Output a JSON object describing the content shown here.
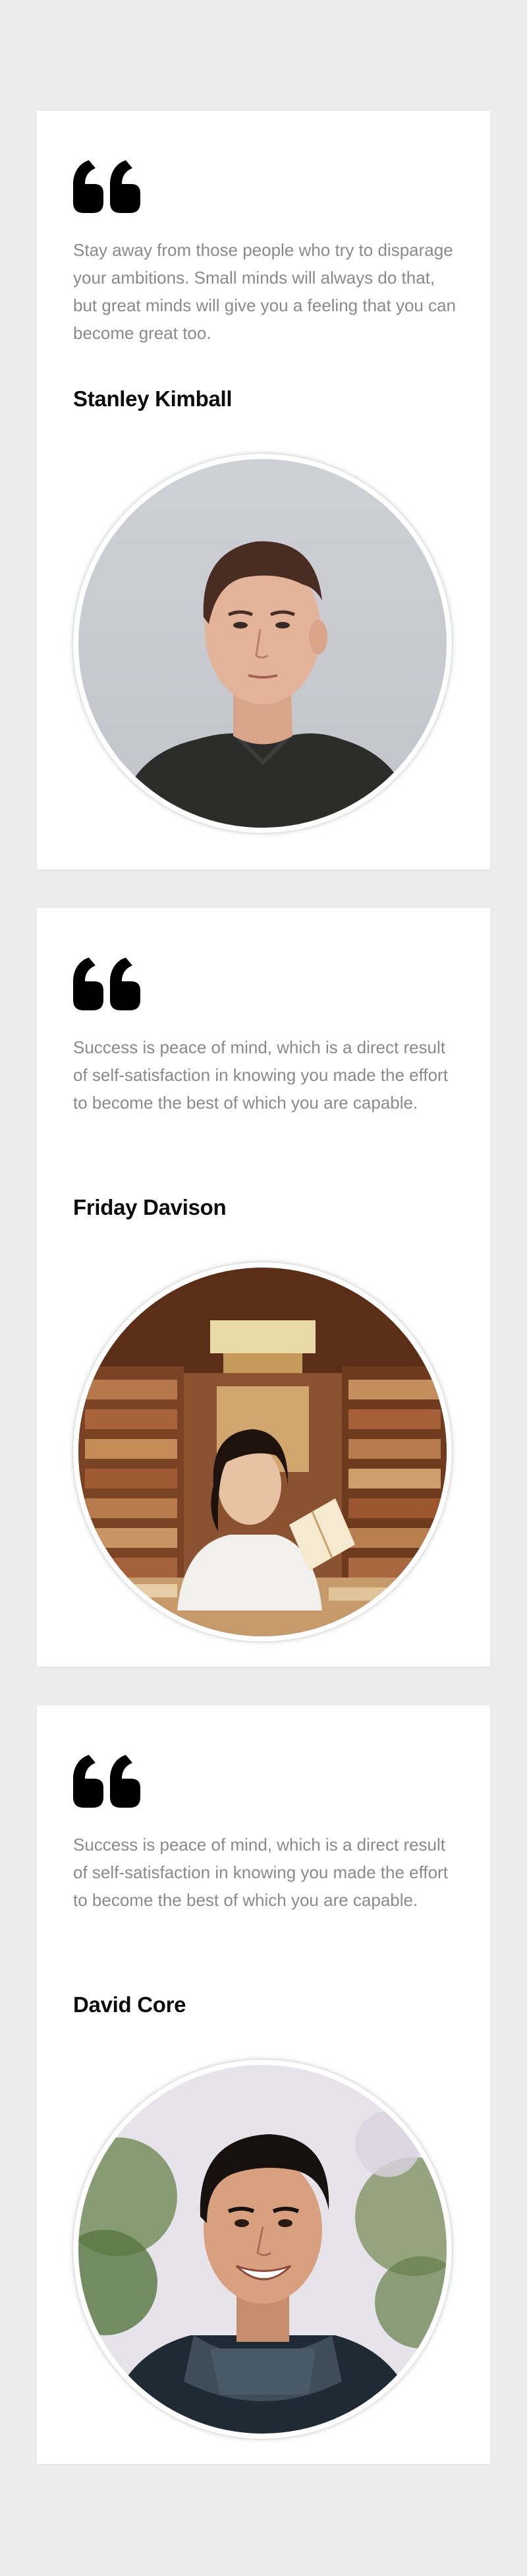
{
  "testimonials": [
    {
      "quote": "Stay away from those people who try to disparage your ambitions. Small minds will always do that, but great minds will give you a feeling that you can become great too.",
      "author": "Stanley Kimball",
      "icon": "quote-icon"
    },
    {
      "quote": "Success is peace of mind, which is a direct result of self-satisfaction in knowing you made the effort to become the best of which you are capable.",
      "author": "Friday Davison",
      "icon": "quote-icon"
    },
    {
      "quote": "Success is peace of mind, which is a direct result of self-satisfaction in knowing you made the effort to become the best of which you are capable.",
      "author": "David Core",
      "icon": "quote-icon"
    }
  ],
  "colors": {
    "page_background": "#ececec",
    "card_background": "#ffffff",
    "quote_text": "#8a8a8a",
    "author_text": "#0c0c0c",
    "quote_icon": "#000000"
  }
}
